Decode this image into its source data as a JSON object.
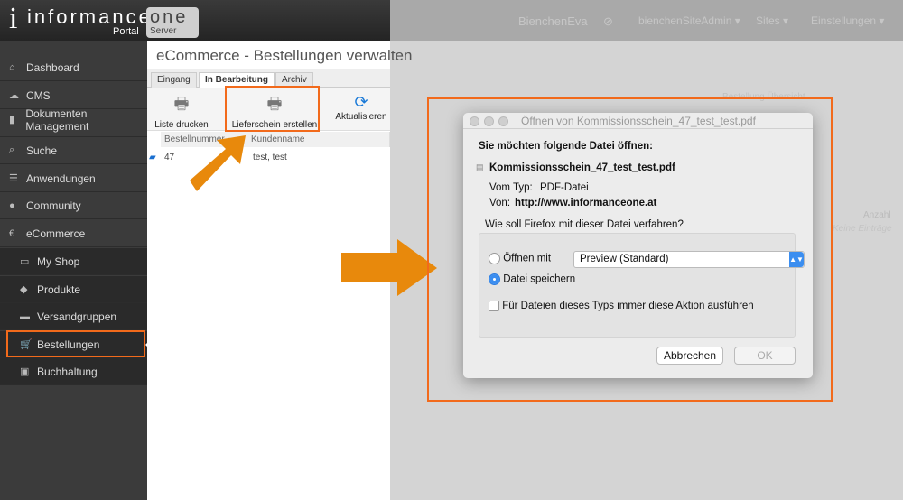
{
  "app": {
    "logo_main": "informance",
    "logo_one": "one",
    "logo_portal": "Portal",
    "logo_server": "Server"
  },
  "topbar": {
    "user": "BienchenEva",
    "role": "bienchenSiteAdmin ▾",
    "sites": "Sites ▾",
    "settings": "Einstellungen ▾"
  },
  "sidebar": {
    "items": [
      {
        "label": "Dashboard",
        "icon": "home-icon",
        "glyph": "⌂"
      },
      {
        "label": "CMS",
        "icon": "cloud-icon",
        "glyph": "☁"
      },
      {
        "label": "Dokumenten Management",
        "icon": "bookmark-icon",
        "glyph": "▮"
      },
      {
        "label": "Suche",
        "icon": "search-icon",
        "glyph": "⌕"
      },
      {
        "label": "Anwendungen",
        "icon": "list-icon",
        "glyph": "☰"
      },
      {
        "label": "Community",
        "icon": "user-icon",
        "glyph": "●"
      },
      {
        "label": "eCommerce",
        "icon": "euro-icon",
        "glyph": "€"
      }
    ],
    "subitems": [
      {
        "label": "My Shop",
        "icon": "monitor-icon",
        "glyph": "▭"
      },
      {
        "label": "Produkte",
        "icon": "tag-icon",
        "glyph": "◆"
      },
      {
        "label": "Versandgruppen",
        "icon": "truck-icon",
        "glyph": "▬"
      },
      {
        "label": "Bestellungen",
        "icon": "cart-icon",
        "glyph": "🛒"
      },
      {
        "label": "Buchhaltung",
        "icon": "money-icon",
        "glyph": "▣"
      }
    ]
  },
  "main": {
    "title": "eCommerce - Bestellungen verwalten",
    "tabs": [
      "Eingang",
      "In Bearbeitung",
      "Archiv"
    ],
    "toolbar": {
      "print_list": "Liste drucken",
      "delivery_note": "Lieferschein erstellen",
      "refresh": "Aktualisieren"
    },
    "columns": [
      "Bestellnummer",
      "Kundenname"
    ],
    "rows": [
      {
        "number": "47",
        "customer": "test, test"
      }
    ]
  },
  "background": {
    "overview": "Bestellung Übersicht",
    "quantity": "Anzahl",
    "empty": "Keine Einträge"
  },
  "dialog": {
    "title": "Öffnen von Kommissionsschein_47_test_test.pdf",
    "heading": "Sie möchten folgende Datei öffnen:",
    "filename": "Kommissionsschein_47_test_test.pdf",
    "type_label": "Vom Typ:",
    "type_value": "PDF-Datei",
    "from_label": "Von:",
    "from_value": "http://www.informanceone.at",
    "question": "Wie soll Firefox mit dieser Datei verfahren?",
    "open_with": "Öffnen mit",
    "open_with_app": "Preview (Standard)",
    "save": "Datei speichern",
    "selected": "save",
    "always": "Für Dateien dieses Typs immer diese Aktion ausführen",
    "always_checked": false,
    "cancel": "Abbrechen",
    "ok": "OK"
  },
  "colors": {
    "accent": "#f26a1b",
    "arrow": "#e8890c"
  }
}
